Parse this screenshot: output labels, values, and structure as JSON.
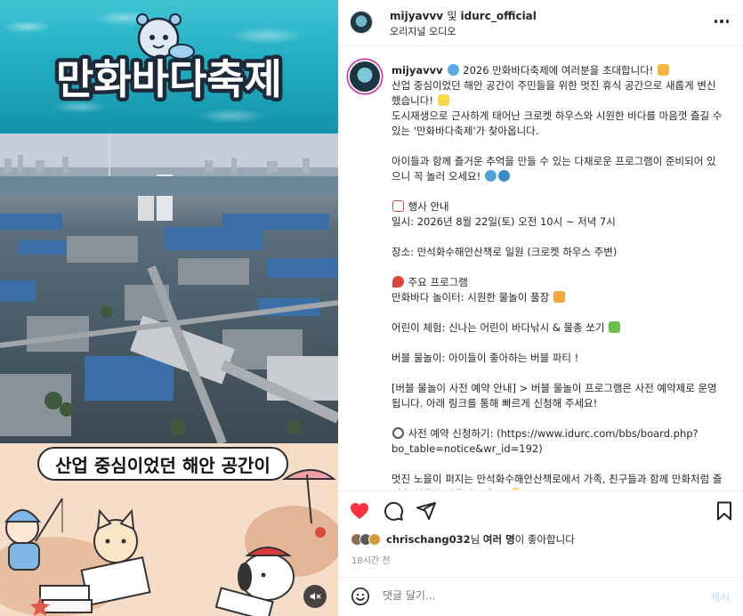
{
  "media": {
    "title_art_text": "만화바다축제",
    "caption_text": "산업 중심이었던 해안 공간이"
  },
  "header": {
    "user1": "mijyavvv",
    "connector": "및",
    "user2": "idurc_official",
    "subtitle": "오리지널 오디오"
  },
  "caption": {
    "username": "mijyavvv",
    "lines": [
      "2026 만화바다축제에 여러분을 초대합니다!",
      "산업 중심이었던 해안 공간이 주민들을 위한 멋진 휴식 공간으로 새롭게 변신했습니다!",
      "도시재생으로 근사하게 태어난 크로켓 하우스와 시원한 바다를 마음껏 즐길 수 있는 '만화바다축제'가 찾아옵니다.",
      "아이들과 함께 즐거운 추억을 만들 수 있는 다채로운 프로그램이 준비되어 있으니 꼭 놀러 오세요!",
      "행사 안내",
      "일시: 2026년 8월 22일(토) 오전 10시 ~ 저녁 7시",
      "장소: 만석화수해안산책로 일원 (크로켓 하우스 주변)",
      "주요 프로그램",
      "만화바다 놀이터: 시원한 물놀이 풀장",
      "어린이 체험: 신나는 어린이 바다낚시 & 물총 쏘기",
      "버블 물놀이: 아이들이 좋아하는 버블 파티 !",
      "[버블 물놀이 사전 예약 안내] > 버블 물놀이 프로그램은 사전 예약제로 운영됩니다. 아래 링크를 통해 빠르게 신청해 주세요!",
      "사전 예약 신청하기: (https://www.idurc.com/bbs/board.php?bo_table=notice&wr_id=192)",
      "멋진 노을이 퍼지는 만석화수해안산책로에서 가족, 친구들과 함께 만화처럼 즐거운 하루를 만들어보세요!"
    ]
  },
  "likes": {
    "user": "chrischang032",
    "suffix1": "님 ",
    "others": "여러 명",
    "suffix2": "이 좋아합니다"
  },
  "time": "18시간 전",
  "comment": {
    "placeholder": "댓글 달기...",
    "post_label": "게시"
  },
  "colors": {
    "like_red": "#ff3040",
    "post_blue": "#b3dbff",
    "story_ring": "#d6249f"
  },
  "icons": [
    "heart-icon",
    "comment-icon",
    "share-icon",
    "bookmark-icon",
    "more-icon",
    "emoji-icon",
    "mute-icon"
  ]
}
